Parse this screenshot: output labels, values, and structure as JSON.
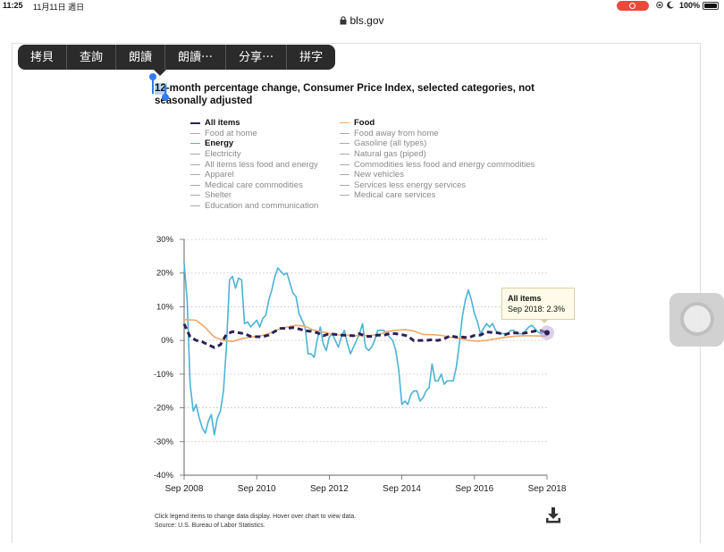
{
  "status_bar": {
    "time": "11:25",
    "date": "11月11日 週日",
    "battery": "100%"
  },
  "browser": {
    "url": "bls.gov",
    "lock_icon": "lock-icon"
  },
  "context_menu": {
    "items": [
      "拷貝",
      "查詢",
      "朗讀",
      "朗讀⋯",
      "分享⋯",
      "拼字"
    ]
  },
  "chart_title": "12-month percentage change, Consumer Price Index, selected categories, not seasonally adjusted",
  "legend": {
    "left": [
      {
        "label": "All items",
        "active": true,
        "style": "dash",
        "color": "#2d2057"
      },
      {
        "label": "Food at home",
        "active": false,
        "color": "#aaaaaa"
      },
      {
        "label": "Energy",
        "active": true,
        "color": "#4bb3d6"
      },
      {
        "label": "Electricity",
        "active": false,
        "color": "#aaaaaa"
      },
      {
        "label": "All items less food and energy",
        "active": false,
        "color": "#aaaaaa"
      },
      {
        "label": "Apparel",
        "active": false,
        "color": "#aaaaaa"
      },
      {
        "label": "Medical care commodities",
        "active": false,
        "color": "#aaaaaa"
      },
      {
        "label": "Shelter",
        "active": false,
        "color": "#aaaaaa"
      },
      {
        "label": "Education and communication",
        "active": false,
        "color": "#aaaaaa"
      }
    ],
    "right": [
      {
        "label": "Food",
        "active": true,
        "color": "#f0a868"
      },
      {
        "label": "Food away from home",
        "active": false,
        "color": "#aaaaaa"
      },
      {
        "label": "Gasoline (all types)",
        "active": false,
        "color": "#aaaaaa"
      },
      {
        "label": "Natural gas (piped)",
        "active": false,
        "color": "#aaaaaa"
      },
      {
        "label": "Commodities less food and energy commodities",
        "active": false,
        "color": "#aaaaaa"
      },
      {
        "label": "New vehicles",
        "active": false,
        "color": "#aaaaaa"
      },
      {
        "label": "Services less energy services",
        "active": false,
        "color": "#aaaaaa"
      },
      {
        "label": "Medical care services",
        "active": false,
        "color": "#aaaaaa"
      }
    ]
  },
  "tooltip": {
    "title": "All items",
    "text": "Sep 2018: 2.3%"
  },
  "footnote": {
    "line1": "Click legend items to change data display. Hover over chart to view data.",
    "line2": "Source: U.S. Bureau of Labor Statistics."
  },
  "icons": {
    "download": "download-icon",
    "assistive_touch": "assistive-touch-icon"
  },
  "chart_data": {
    "type": "line",
    "ylim": [
      -40,
      30
    ],
    "y_ticks": [
      30,
      20,
      10,
      0,
      -10,
      -20,
      -30,
      -40
    ],
    "y_tick_labels": [
      "30%",
      "20%",
      "10%",
      "0%",
      "-10%",
      "-20%",
      "-30%",
      "-40%"
    ],
    "xlim": [
      2008.667,
      2018.667
    ],
    "x_ticks": [
      2008.667,
      2010.667,
      2012.667,
      2014.667,
      2016.667,
      2018.667
    ],
    "x_tick_labels": [
      "Sep 2008",
      "Sep 2010",
      "Sep 2012",
      "Sep 2014",
      "Sep 2016",
      "Sep 2018"
    ],
    "grid": "horizontal dotted",
    "series": [
      {
        "name": "Energy",
        "color": "#4bb3d6",
        "style": "solid",
        "x": [
          2008.667,
          2008.75,
          2008.833,
          2008.917,
          2009.0,
          2009.083,
          2009.167,
          2009.25,
          2009.333,
          2009.417,
          2009.5,
          2009.583,
          2009.667,
          2009.75,
          2009.833,
          2009.917,
          2010.0,
          2010.083,
          2010.167,
          2010.25,
          2010.333,
          2010.417,
          2010.5,
          2010.583,
          2010.667,
          2010.75,
          2010.833,
          2010.917,
          2011.0,
          2011.083,
          2011.167,
          2011.25,
          2011.333,
          2011.417,
          2011.5,
          2011.583,
          2011.667,
          2011.75,
          2011.833,
          2011.917,
          2012.0,
          2012.083,
          2012.167,
          2012.25,
          2012.333,
          2012.417,
          2012.5,
          2012.583,
          2012.667,
          2012.75,
          2012.833,
          2012.917,
          2013.0,
          2013.083,
          2013.167,
          2013.25,
          2013.333,
          2013.417,
          2013.5,
          2013.583,
          2013.667,
          2013.75,
          2013.833,
          2013.917,
          2014.0,
          2014.083,
          2014.167,
          2014.25,
          2014.333,
          2014.417,
          2014.5,
          2014.583,
          2014.667,
          2014.75,
          2014.833,
          2014.917,
          2015.0,
          2015.083,
          2015.167,
          2015.25,
          2015.333,
          2015.417,
          2015.5,
          2015.583,
          2015.667,
          2015.75,
          2015.833,
          2015.917,
          2016.0,
          2016.083,
          2016.167,
          2016.25,
          2016.333,
          2016.417,
          2016.5,
          2016.583,
          2016.667,
          2016.75,
          2016.833,
          2016.917,
          2017.0,
          2017.083,
          2017.167,
          2017.25,
          2017.333,
          2017.417,
          2017.5,
          2017.583,
          2017.667,
          2017.75,
          2017.833,
          2017.917,
          2018.0,
          2018.083,
          2018.167,
          2018.25,
          2018.333,
          2018.417,
          2018.5,
          2018.583,
          2018.667
        ],
        "y": [
          23.0,
          12.0,
          -13.0,
          -21.0,
          -19.0,
          -23.0,
          -26.0,
          -27.5,
          -24.0,
          -22.0,
          -28.0,
          -23.0,
          -21.0,
          -15.0,
          -2.0,
          18.0,
          19.0,
          15.5,
          18.5,
          18.0,
          5.0,
          5.5,
          4.0,
          5.0,
          6.0,
          4.0,
          6.5,
          7.5,
          12.0,
          15.0,
          19.0,
          21.5,
          20.5,
          19.5,
          20.0,
          17.0,
          14.0,
          13.0,
          8.0,
          6.0,
          4.0,
          -4.0,
          -4.0,
          -5.0,
          0.0,
          4.0,
          -1.0,
          -3.0,
          1.0,
          2.0,
          0.0,
          -2.0,
          1.0,
          3.0,
          -1.0,
          -4.0,
          -2.0,
          0.0,
          2.0,
          5.0,
          -2.0,
          -3.0,
          -2.0,
          0.0,
          3.0,
          3.0,
          3.0,
          2.0,
          1.0,
          0.0,
          -3.0,
          -9.0,
          -19.0,
          -18.0,
          -19.0,
          -16.0,
          -15.0,
          -15.0,
          -18.0,
          -17.0,
          -15.0,
          -14.0,
          -7.0,
          -12.0,
          -12.0,
          -10.0,
          -13.0,
          -12.0,
          -12.0,
          -12.0,
          -8.0,
          -1.0,
          7.0,
          12.0,
          15.0,
          12.0,
          8.0,
          5.5,
          2.0,
          3.5,
          5.0,
          4.0,
          5.0,
          3.0,
          2.0,
          2.0,
          2.0,
          2.0,
          3.0,
          3.0,
          2.0,
          2.0,
          2.0,
          3.0,
          4.0,
          4.5,
          3.5,
          2.5,
          2.0,
          2.5,
          2.5
        ]
      },
      {
        "name": "Food",
        "color": "#f0a868",
        "style": "solid",
        "x": [
          2008.667,
          2009.0,
          2009.25,
          2009.5,
          2009.75,
          2010.0,
          2010.25,
          2010.5,
          2010.75,
          2011.0,
          2011.25,
          2011.5,
          2011.75,
          2012.0,
          2012.25,
          2012.5,
          2012.75,
          2013.0,
          2013.25,
          2013.5,
          2013.75,
          2014.0,
          2014.25,
          2014.5,
          2014.75,
          2015.0,
          2015.25,
          2015.5,
          2015.75,
          2016.0,
          2016.25,
          2016.5,
          2016.75,
          2017.0,
          2017.25,
          2017.5,
          2017.75,
          2018.0,
          2018.25,
          2018.5,
          2018.667
        ],
        "y": [
          6.2,
          6.0,
          3.8,
          1.0,
          0.0,
          -0.3,
          0.5,
          1.0,
          1.3,
          2.0,
          3.2,
          4.0,
          4.5,
          4.2,
          3.0,
          2.5,
          1.8,
          1.6,
          1.5,
          1.4,
          1.5,
          1.6,
          2.6,
          3.0,
          3.2,
          2.8,
          1.8,
          1.7,
          1.5,
          1.0,
          0.6,
          0.0,
          -0.2,
          0.0,
          0.5,
          0.9,
          1.2,
          1.4,
          1.4,
          1.3,
          1.4
        ]
      },
      {
        "name": "All items",
        "color": "#2d2057",
        "style": "dash",
        "x": [
          2008.667,
          2008.833,
          2009.0,
          2009.167,
          2009.333,
          2009.5,
          2009.667,
          2009.833,
          2010.0,
          2010.167,
          2010.333,
          2010.5,
          2010.667,
          2010.833,
          2011.0,
          2011.167,
          2011.333,
          2011.5,
          2011.667,
          2011.833,
          2012.0,
          2012.167,
          2012.333,
          2012.5,
          2012.667,
          2012.833,
          2013.0,
          2013.167,
          2013.333,
          2013.5,
          2013.667,
          2013.833,
          2014.0,
          2014.167,
          2014.333,
          2014.5,
          2014.667,
          2014.833,
          2015.0,
          2015.167,
          2015.333,
          2015.5,
          2015.667,
          2015.833,
          2016.0,
          2016.167,
          2016.333,
          2016.5,
          2016.667,
          2016.833,
          2017.0,
          2017.167,
          2017.333,
          2017.5,
          2017.667,
          2017.833,
          2018.0,
          2018.167,
          2018.333,
          2018.5,
          2018.667
        ],
        "y": [
          4.9,
          1.1,
          0.0,
          -0.4,
          -1.3,
          -2.1,
          -1.3,
          1.8,
          2.6,
          2.3,
          2.0,
          1.2,
          1.1,
          1.1,
          1.6,
          2.7,
          3.6,
          3.6,
          3.8,
          3.4,
          2.9,
          2.7,
          2.3,
          1.4,
          2.0,
          1.8,
          1.6,
          1.5,
          1.4,
          2.0,
          1.2,
          1.2,
          1.6,
          1.5,
          2.1,
          2.0,
          1.7,
          1.3,
          -0.1,
          0.0,
          0.0,
          0.2,
          0.0,
          0.5,
          1.4,
          1.0,
          1.0,
          0.8,
          1.5,
          1.6,
          2.5,
          2.4,
          2.2,
          1.7,
          2.2,
          2.2,
          2.1,
          2.4,
          2.8,
          2.9,
          2.3
        ]
      }
    ]
  }
}
